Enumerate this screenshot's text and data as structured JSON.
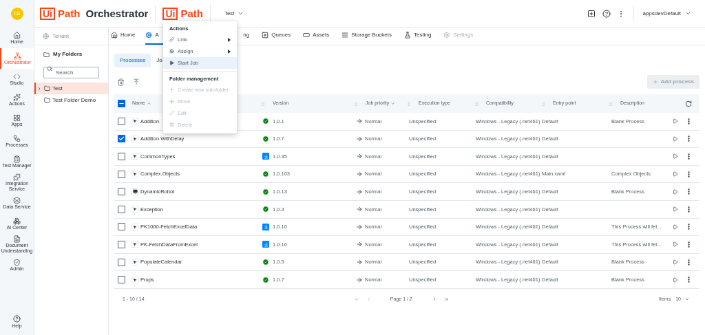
{
  "header": {
    "avatar": "CS",
    "logo": {
      "mark": "Ui",
      "word": "Path",
      "product": "Orchestrator"
    },
    "tenant_logo": {
      "mark": "Ui",
      "word": "Path"
    },
    "folder_selector": "Test",
    "user": "appsdevDefault"
  },
  "rail": {
    "items": [
      {
        "label": "Home",
        "selected": false
      },
      {
        "label": "Orchestrator",
        "selected": true
      },
      {
        "label": "Studio",
        "selected": false
      },
      {
        "label": "Actions",
        "selected": false
      },
      {
        "label": "Apps",
        "selected": false
      },
      {
        "label": "Processes",
        "selected": false
      },
      {
        "label": "Test Manager",
        "selected": false
      },
      {
        "label": "Integration Service",
        "selected": false
      },
      {
        "label": "Data Service",
        "selected": false
      },
      {
        "label": "AI Center",
        "selected": false
      },
      {
        "label": "Document Understanding",
        "selected": false
      },
      {
        "label": "Admin",
        "selected": false
      }
    ],
    "help": "Help"
  },
  "folders": {
    "tenant": "Tenant",
    "my_folders": "My Folders",
    "search": {
      "placeholder": "Search"
    },
    "tree": [
      {
        "label": "Test",
        "selected": true,
        "expandable": true
      },
      {
        "label": "Test Folder Demo",
        "selected": false,
        "expandable": false
      }
    ]
  },
  "tabs": [
    {
      "label": "Home",
      "selected": false,
      "disabled": false
    },
    {
      "label": "A",
      "selected": true,
      "disabled": false
    },
    {
      "label": "ng",
      "selected": false,
      "disabled": false
    },
    {
      "label": "Queues",
      "selected": false,
      "disabled": false
    },
    {
      "label": "Assets",
      "selected": false,
      "disabled": false
    },
    {
      "label": "Storage Buckets",
      "selected": false,
      "disabled": false
    },
    {
      "label": "Testing",
      "selected": false,
      "disabled": false
    },
    {
      "label": "Settings",
      "selected": false,
      "disabled": true
    }
  ],
  "subtabs": [
    {
      "label": "Processes",
      "selected": true
    },
    {
      "label": "Jo",
      "selected": false
    }
  ],
  "add_button": {
    "label": "Add process",
    "disabled": true
  },
  "table": {
    "select_all": {
      "indeterminate": true
    },
    "columns": [
      "Name",
      "Version",
      "Job priority",
      "Execution type",
      "Compatibility",
      "Entry point",
      "Description"
    ],
    "rows": [
      {
        "checked": false,
        "kind": "pointer",
        "name": "Addition",
        "update_available": false,
        "version": "1.0.1",
        "priority": "Normal",
        "execution_type": "Unspecified",
        "compatibility": "Windows - Legacy (.net461)",
        "entry_point": "Default",
        "description": "Blank Process"
      },
      {
        "checked": true,
        "kind": "pointer",
        "name": "Addition.WithDelay",
        "update_available": false,
        "version": "1.0.7",
        "priority": "Normal",
        "execution_type": "Unspecified",
        "compatibility": "Windows - Legacy (.net461)",
        "entry_point": "Default"
      },
      {
        "checked": false,
        "kind": "pointer",
        "name": "CommonTypes",
        "update_available": true,
        "version": "1.0.35",
        "priority": "Normal",
        "execution_type": "Unspecified",
        "compatibility": "Windows - Legacy (.net461)",
        "entry_point": "Default"
      },
      {
        "checked": false,
        "kind": "pointer",
        "name": "Complex.Objects",
        "update_available": false,
        "version": "1.0.103",
        "priority": "Normal",
        "execution_type": "Unspecified",
        "compatibility": "Windows - Legacy (.net461)",
        "entry_point": "Main.xaml",
        "description": "Complex Objects"
      },
      {
        "checked": false,
        "kind": "screen",
        "name": "DynamicRobot",
        "update_available": false,
        "version": "1.0.13",
        "priority": "Normal",
        "execution_type": "Unspecified",
        "compatibility": "Windows - Legacy (.net461)",
        "entry_point": "Default",
        "description": "Blank Process"
      },
      {
        "checked": false,
        "kind": "pointer",
        "name": "Exception",
        "update_available": false,
        "version": "1.0.3",
        "priority": "Normal",
        "execution_type": "Unspecified",
        "compatibility": "Windows - Legacy (.net461)",
        "entry_point": "Default"
      },
      {
        "checked": false,
        "kind": "pointer",
        "name": "PK1000-FetchExcelData",
        "update_available": true,
        "version": "1.0.10",
        "priority": "Normal",
        "execution_type": "Unspecified",
        "compatibility": "Windows - Legacy (.net461)",
        "entry_point": "Default",
        "description": "This Process will fet..."
      },
      {
        "checked": false,
        "kind": "pointer",
        "name": "PK-FetchDataFromExcel",
        "update_available": true,
        "version": "1.0.10",
        "priority": "Normal",
        "execution_type": "Unspecified",
        "compatibility": "Windows - Legacy (.net461)",
        "entry_point": "Default",
        "description": "This Process will fet..."
      },
      {
        "checked": false,
        "kind": "pointer",
        "name": "PopulateCalendar",
        "update_available": false,
        "version": "1.0.5",
        "priority": "Normal",
        "execution_type": "Unspecified",
        "compatibility": "Windows - Legacy (.net461)",
        "entry_point": "Default",
        "description": "Blank Process"
      },
      {
        "checked": false,
        "kind": "pointer",
        "name": "Props",
        "update_available": false,
        "version": "1.0.7",
        "priority": "Normal",
        "execution_type": "Unspecified",
        "compatibility": "Windows - Legacy (.net461)",
        "entry_point": "Default",
        "description": "Blank Process"
      }
    ]
  },
  "pagination": {
    "range": "1 - 10 / 14",
    "page": "Page 1 / 2",
    "items_label": "Items",
    "items_value": "10"
  },
  "menu": {
    "sections": [
      {
        "title": "Actions",
        "items": [
          {
            "label": "Link",
            "submenu": true,
            "selected": false,
            "disabled": false
          },
          {
            "label": "Assign",
            "submenu": true,
            "selected": false,
            "disabled": false
          },
          {
            "label": "Start Job",
            "submenu": false,
            "selected": true,
            "disabled": false
          }
        ]
      },
      {
        "title": "Folder management",
        "items": [
          {
            "label": "Create new sub-folder",
            "submenu": false,
            "selected": false,
            "disabled": true
          },
          {
            "label": "Move",
            "submenu": false,
            "selected": false,
            "disabled": true
          },
          {
            "label": "Edit",
            "submenu": false,
            "selected": false,
            "disabled": true
          },
          {
            "label": "Delete",
            "submenu": false,
            "selected": false,
            "disabled": true
          }
        ]
      }
    ]
  }
}
